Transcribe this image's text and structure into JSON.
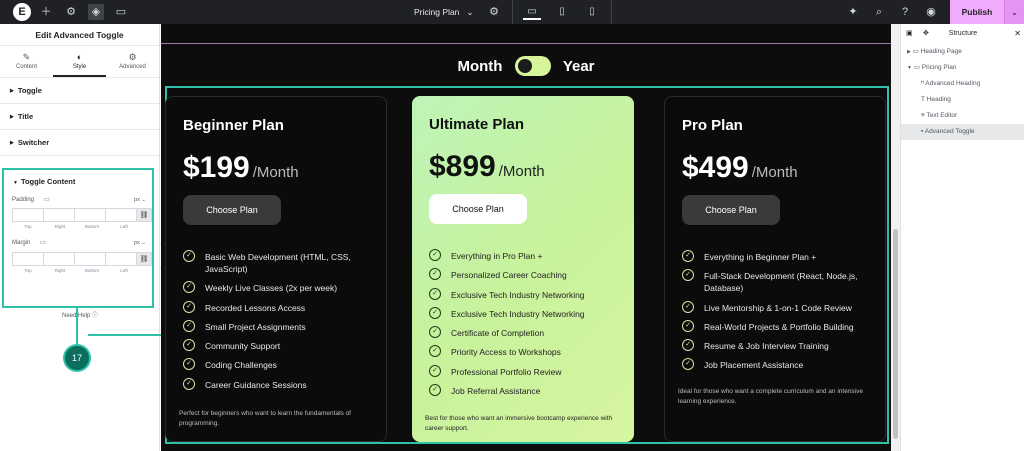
{
  "topbar": {
    "page_name": "Pricing Plan",
    "publish_label": "Publish",
    "colors": {
      "bg": "#1f2124",
      "publish": "#f0abfc"
    }
  },
  "left_panel": {
    "title": "Edit Advanced Toggle",
    "tabs": [
      {
        "label": "Content",
        "icon": "pencil-icon"
      },
      {
        "label": "Style",
        "icon": "half-circle-icon"
      },
      {
        "label": "Advanced",
        "icon": "gear-icon"
      }
    ],
    "sections": [
      "Toggle",
      "Title",
      "Switcher"
    ],
    "toggle_content": {
      "heading": "Toggle Content",
      "padding_label": "Padding",
      "margin_label": "Margin",
      "unit": "px",
      "dim_labels": [
        "Top",
        "Right",
        "Bottom",
        "Left"
      ]
    },
    "need_help": "Need Help",
    "step_number": "17"
  },
  "canvas": {
    "toggle": {
      "left": "Month",
      "right": "Year"
    },
    "accent": "#2dc2a5",
    "plans": [
      {
        "title": "Beginner Plan",
        "price": "$199",
        "period": "/Month",
        "button": "Choose Plan",
        "features": [
          "Basic Web Development (HTML, CSS, JavaScript)",
          "Weekly Live Classes (2x per week)",
          "Recorded Lessons Access",
          "Small Project Assignments",
          "Community Support",
          "Coding Challenges",
          "Career Guidance Sessions"
        ],
        "description": "Perfect for beginners who want to learn the fundamentals of programming."
      },
      {
        "title": "Ultimate Plan",
        "price": "$899",
        "period": "/Month",
        "button": "Choose Plan",
        "features": [
          "Everything in Pro Plan +",
          "Personalized Career Coaching",
          "Exclusive Tech Industry Networking",
          "Exclusive Tech Industry Networking",
          "Certificate of Completion",
          "Priority Access to Workshops",
          "Professional Portfolio Review",
          "Job Referral Assistance"
        ],
        "description": "Best for those who want an immersive bootcamp experience with career support."
      },
      {
        "title": "Pro Plan",
        "price": "$499",
        "period": "/Month",
        "button": "Choose Plan",
        "features": [
          "Everything in Beginner Plan +",
          "Full-Stack Development (React, Node.js, Database)",
          "Live Mentorship & 1-on-1 Code Review",
          "Real-World Projects & Portfolio Building",
          "Resume & Job Interview Training",
          "Job Placement Assistance"
        ],
        "description": "Ideal for those who want a complete curriculum and an intensive learning experience."
      }
    ]
  },
  "structure": {
    "title": "Structure",
    "items": [
      {
        "label": "Heading Page",
        "icon": "container-icon"
      },
      {
        "label": "Pricing Plan",
        "icon": "container-icon"
      },
      {
        "label": "Advanced Heading",
        "icon": "advanced-heading-icon"
      },
      {
        "label": "Heading",
        "icon": "heading-icon"
      },
      {
        "label": "Text Editor",
        "icon": "text-editor-icon"
      },
      {
        "label": "Advanced Toggle",
        "icon": "toggle-icon"
      }
    ]
  }
}
